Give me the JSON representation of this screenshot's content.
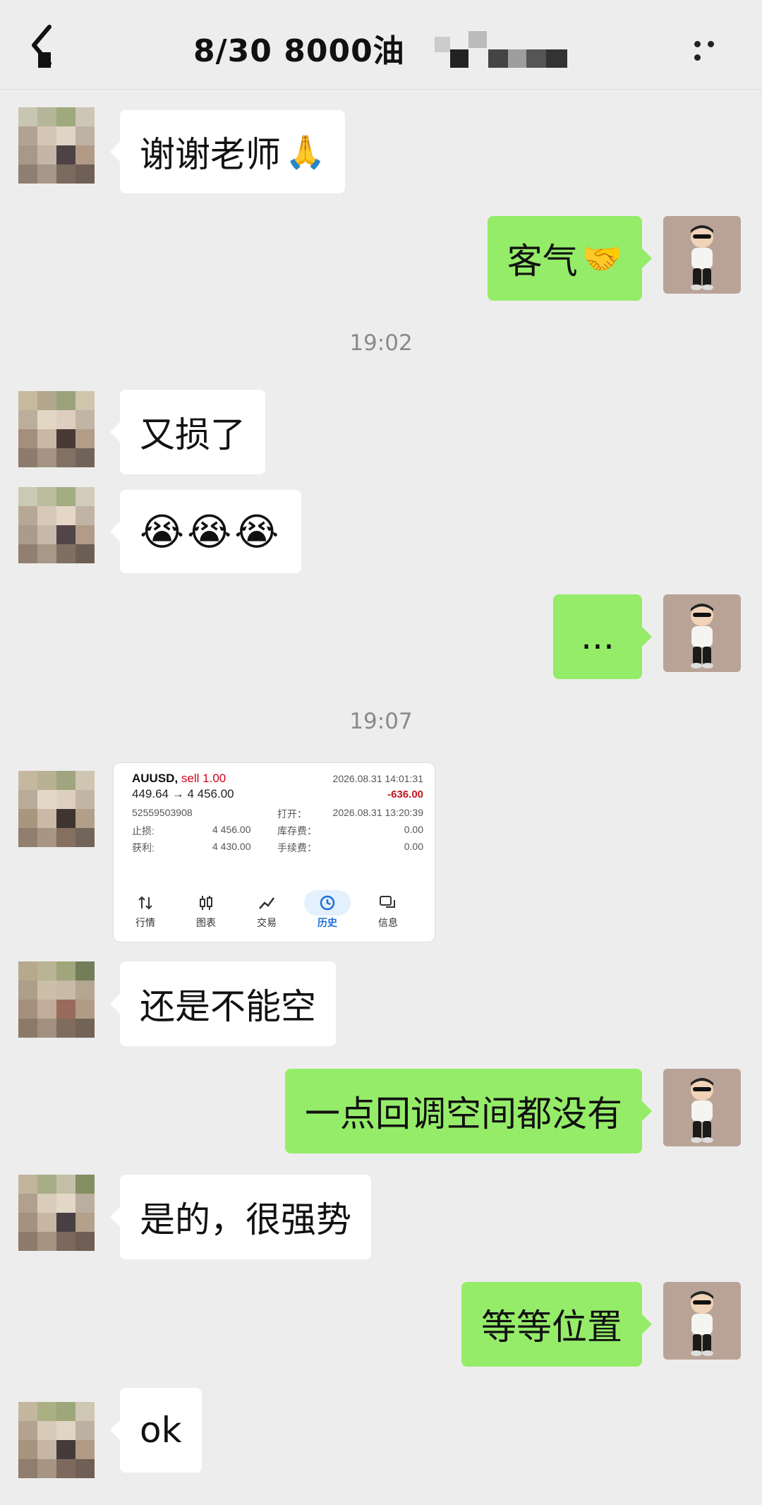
{
  "header": {
    "title": "8/30  8000油",
    "back_icon": "back-arrow-icon",
    "more_icon": "more-dots-icon"
  },
  "messages": [
    {
      "side": "left",
      "text": "谢谢老师",
      "emoji": "🙏"
    },
    {
      "side": "right",
      "text": "客气",
      "emoji": "🤝"
    },
    {
      "type": "time",
      "text": "19:02"
    },
    {
      "side": "left",
      "text": "又损了"
    },
    {
      "side": "left",
      "text": "",
      "emoji": "😭😭😭"
    },
    {
      "side": "right",
      "text": "..."
    },
    {
      "type": "time",
      "text": "19:07"
    },
    {
      "side": "left",
      "type": "image"
    },
    {
      "side": "left",
      "text": "还是不能空"
    },
    {
      "side": "right",
      "text": "一点回调空间都没有"
    },
    {
      "side": "left",
      "text": "是的，很强势"
    },
    {
      "side": "right",
      "text": "等等位置"
    },
    {
      "side": "left",
      "text": "ok"
    }
  ],
  "trade_card": {
    "symbol": "AUUSD,",
    "side": "sell 1.00",
    "price": "449.64 → 4 456.00",
    "close_time": "2026.08.31 14:01:31",
    "pnl": "-636.00",
    "order": "52559503908",
    "open_label": "打开：",
    "open_time": "2026.08.31 13:20:39",
    "sl_label": "止损:",
    "sl_value": "4 456.00",
    "swap_label": "库存费：",
    "swap_value": "0.00",
    "tp_label": "获利:",
    "tp_value": "4 430.00",
    "fee_label": "手续费：",
    "fee_value": "0.00",
    "tabs": [
      "行情",
      "图表",
      "交易",
      "历史",
      "信息"
    ],
    "active_tab": "历史"
  },
  "colors": {
    "background": "#ededed",
    "bubble_self": "#95ec69",
    "bubble_other": "#ffffff",
    "loss": "#c0171d",
    "active_tab": "#1e6fd9"
  }
}
